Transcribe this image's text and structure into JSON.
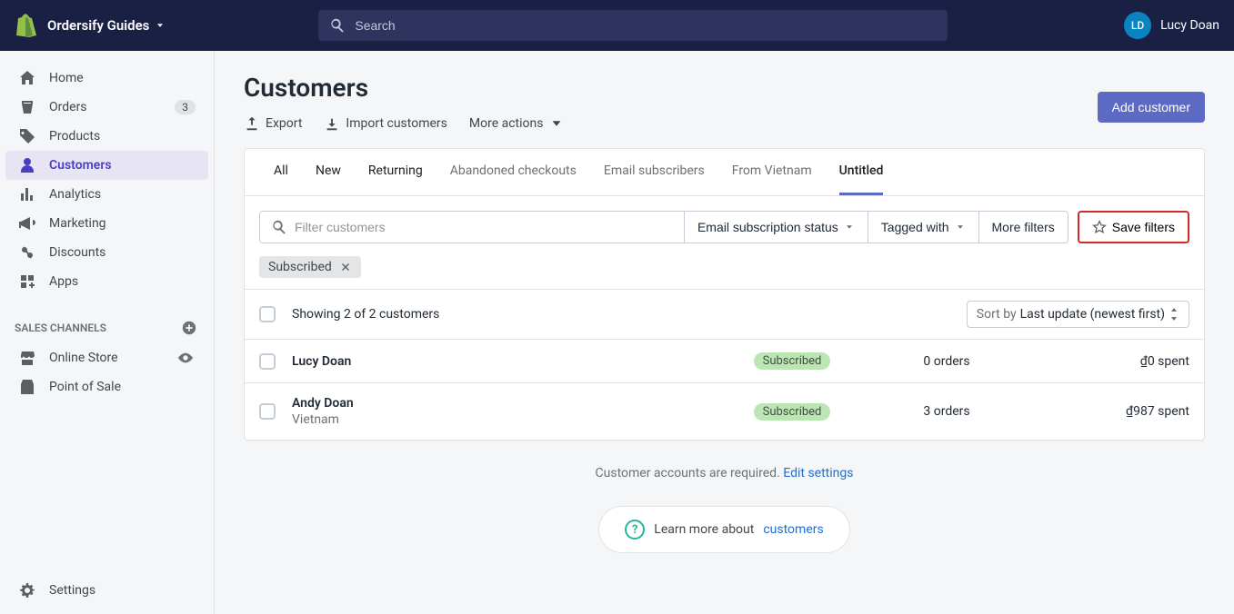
{
  "topbar": {
    "store_name": "Ordersify Guides",
    "search_placeholder": "Search",
    "user_initials": "LD",
    "user_name": "Lucy Doan"
  },
  "sidebar": {
    "items": [
      {
        "label": "Home",
        "icon": "home"
      },
      {
        "label": "Orders",
        "icon": "orders",
        "badge": "3"
      },
      {
        "label": "Products",
        "icon": "products"
      },
      {
        "label": "Customers",
        "icon": "customers",
        "active": true
      },
      {
        "label": "Analytics",
        "icon": "analytics"
      },
      {
        "label": "Marketing",
        "icon": "marketing"
      },
      {
        "label": "Discounts",
        "icon": "discounts"
      },
      {
        "label": "Apps",
        "icon": "apps"
      }
    ],
    "sales_channels_title": "SALES CHANNELS",
    "channels": [
      {
        "label": "Online Store",
        "icon": "store",
        "trailing": "eye"
      },
      {
        "label": "Point of Sale",
        "icon": "pos"
      }
    ],
    "settings_label": "Settings"
  },
  "page": {
    "title": "Customers",
    "export_label": "Export",
    "import_label": "Import customers",
    "more_actions_label": "More actions",
    "add_customer_label": "Add customer"
  },
  "tabs": [
    "All",
    "New",
    "Returning",
    "Abandoned checkouts",
    "Email subscribers",
    "From Vietnam",
    "Untitled"
  ],
  "active_tab_index": 6,
  "filters": {
    "search_placeholder": "Filter customers",
    "email_sub_label": "Email subscription status",
    "tagged_with_label": "Tagged with",
    "more_filters_label": "More filters",
    "save_filters_label": "Save filters",
    "applied": [
      {
        "label": "Subscribed"
      }
    ]
  },
  "list_header": {
    "showing_text": "Showing 2 of 2 customers",
    "sort_by_label": "Sort by",
    "sort_value": "Last update (newest first)"
  },
  "rows": [
    {
      "name": "Lucy Doan",
      "sub": "",
      "status": "Subscribed",
      "orders": "0 orders",
      "spent": "₫0 spent"
    },
    {
      "name": "Andy Doan",
      "sub": "Vietnam",
      "status": "Subscribed",
      "orders": "3 orders",
      "spent": "₫987 spent"
    }
  ],
  "footnote": {
    "text": "Customer accounts are required.",
    "link": "Edit settings"
  },
  "learn_more": {
    "text": "Learn more about",
    "link": "customers"
  }
}
